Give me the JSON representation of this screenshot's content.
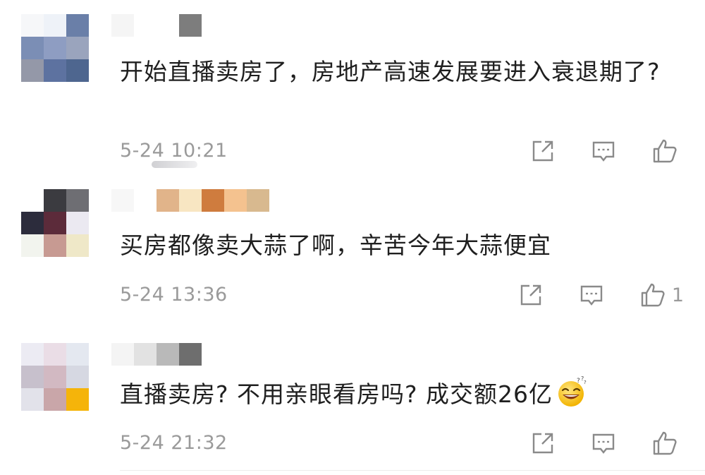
{
  "comments": [
    {
      "avatar_colors": [
        "#f6f7f9",
        "#eef2f8",
        "#6a7fa8",
        "#7b8eb5",
        "#8e9dc2",
        "#9aa4bd",
        "#9498a8",
        "#5d72a0",
        "#4e668f"
      ],
      "username_colors": [
        "#f5f5f5",
        "#ffffff",
        "#ffffff",
        "#7d7d7d"
      ],
      "content": "开始直播卖房了，房地产高速发展要进入衰退期了?",
      "timestamp": "5-24 10:21",
      "like_count": ""
    },
    {
      "avatar_colors": [
        "#ffffff",
        "#3b3b40",
        "#6e6e73",
        "#2c2c3c",
        "#5c2b3a",
        "#ebe9f1",
        "#f2f4ee",
        "#c79a92",
        "#efe8c8"
      ],
      "username_colors": [
        "#f7f7f7",
        "#ffffff",
        "#e1b48a",
        "#f8e6c2",
        "#cf7c3e",
        "#f4c28f",
        "#d8b98f",
        "#ffffff"
      ],
      "content": "买房都像卖大蒜了啊，辛苦今年大蒜便宜",
      "timestamp": "5-24 13:36",
      "like_count": "1"
    },
    {
      "avatar_colors": [
        "#ecebf3",
        "#eadde6",
        "#e4e8f0",
        "#c7c0cc",
        "#d2b9c2",
        "#d6d8e2",
        "#e2e2ea",
        "#c9a6a9",
        "#f5b40a"
      ],
      "username_colors": [
        "#f4f4f4",
        "#e2e2e2",
        "#b9b9b9",
        "#6e6e6e"
      ],
      "content": "直播卖房? 不用亲眼看房吗? 成交额26亿",
      "timestamp": "5-24 21:32",
      "like_count": ""
    }
  ],
  "icons": {
    "share": "share-icon",
    "reply": "comment-icon",
    "like": "thumbs-up-icon",
    "emoji": "sweat-grin-emoji-icon"
  },
  "colors": {
    "meta_text": "#9a9a9a",
    "icon_stroke": "#8a8a8a"
  }
}
